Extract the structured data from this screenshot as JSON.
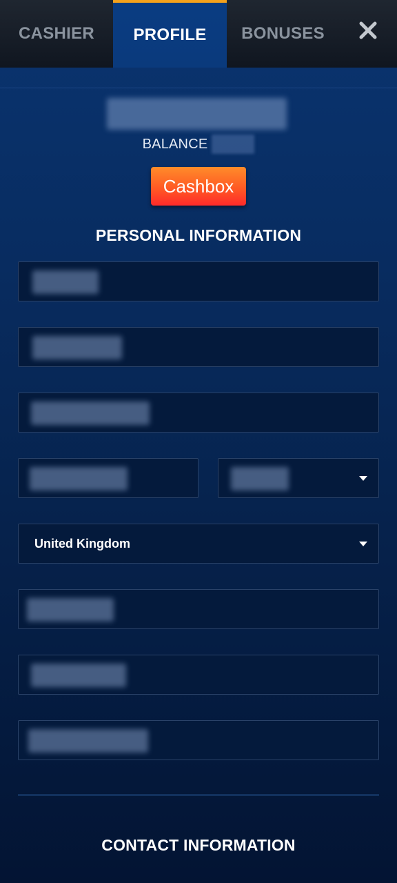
{
  "tabs": [
    {
      "label": "CASHIER",
      "active": false
    },
    {
      "label": "PROFILE",
      "active": true
    },
    {
      "label": "BONUSES",
      "active": false
    }
  ],
  "close_icon": "close-icon",
  "profile": {
    "username": "",
    "balance_label": "BALANCE",
    "balance_value": "",
    "cashbox_label": "Cashbox"
  },
  "personal_information": {
    "title": "PERSONAL INFORMATION",
    "country_value": "United Kingdom"
  },
  "contact_information": {
    "title": "CONTACT INFORMATION"
  },
  "colors": {
    "active_tab_accent": "#f5a21c",
    "cashbox_button": "#ff4a24",
    "field_background": "#041a3c"
  }
}
